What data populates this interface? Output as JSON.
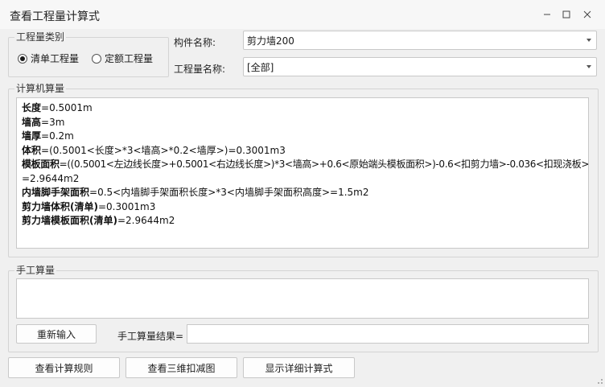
{
  "window": {
    "title": "查看工程量计算式",
    "controls": {
      "minimize_icon": "minimize-icon",
      "maximize_icon": "maximize-icon",
      "close_icon": "close-icon"
    }
  },
  "quantity_type": {
    "legend": "工程量类别",
    "options": [
      {
        "label": "清单工程量",
        "selected": true
      },
      {
        "label": "定额工程量",
        "selected": false
      }
    ]
  },
  "component": {
    "label": "构件名称:",
    "value": "剪力墙200"
  },
  "quantity_name": {
    "label": "工程量名称:",
    "value": "[全部]"
  },
  "computer_calc": {
    "legend": "计算机算量",
    "lines": [
      {
        "name": "长度",
        "expr": "=0.5001m"
      },
      {
        "name": "墙高",
        "expr": "=3m"
      },
      {
        "name": "墙厚",
        "expr": "=0.2m"
      },
      {
        "name": "体积",
        "expr": "=(0.5001<长度>*3<墙高>*0.2<墙厚>)=0.3001m3"
      },
      {
        "name": "模板面积",
        "expr": "=((0.5001<左边线长度>+0.5001<右边线长度>)*3<墙高>+0.6<原始端头模板面积>)-0.6<扣剪力墙>-0.036<扣现浇板>"
      },
      {
        "name": "",
        "expr": "=2.9644m2"
      },
      {
        "name": "内墙脚手架面积",
        "expr": "=0.5<内墙脚手架面积长度>*3<内墙脚手架面积高度>=1.5m2"
      },
      {
        "name": "剪力墙体积(清单)",
        "expr": "=0.3001m3"
      },
      {
        "name": "剪力墙模板面积(清单)",
        "expr": "=2.9644m2"
      }
    ]
  },
  "manual_calc": {
    "legend": "手工算量",
    "reinput_label": "重新输入",
    "result_label": "手工算量结果=",
    "result_value": ""
  },
  "bottom_buttons": {
    "view_rules": "查看计算规则",
    "view_3d": "查看三维扣减图",
    "show_detail": "显示详细计算式"
  }
}
